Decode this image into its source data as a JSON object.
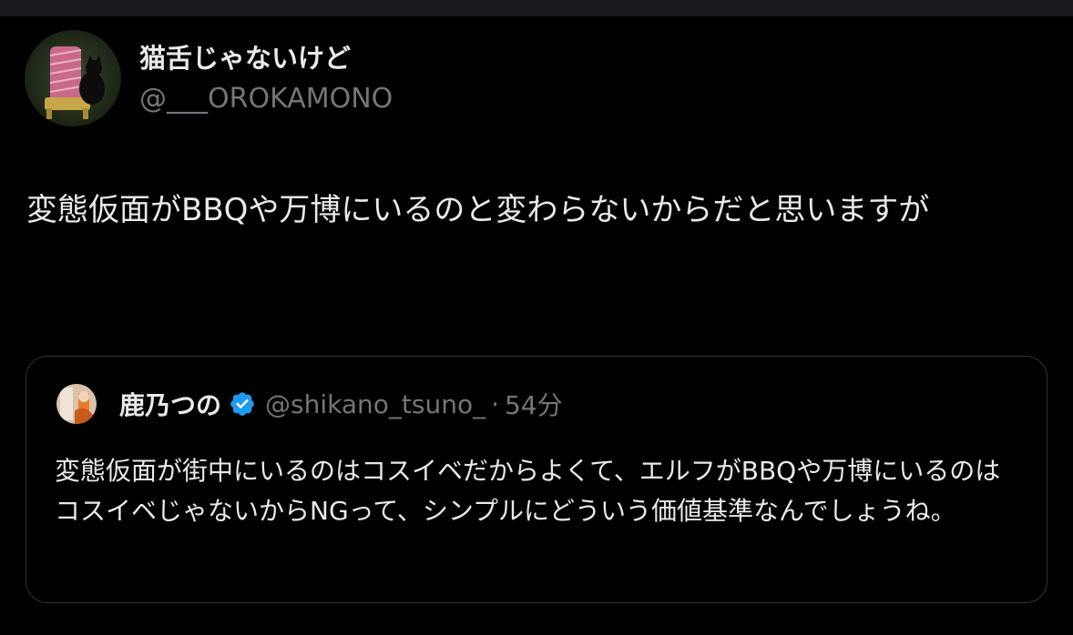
{
  "post": {
    "author_name": "猫舌じゃないけど",
    "author_handle": "@___OROKAMONO",
    "text": "変態仮面がBBQや万博にいるのと変わらないからだと思いますが"
  },
  "quoted": {
    "author_name": "鹿乃つの",
    "author_handle": "@shikano_tsuno_",
    "separator": "·",
    "time": "54分",
    "text": "変態仮面が街中にいるのはコスイベだからよくて、エルフがBBQや万博にいるのはコスイベじゃないからNGって、シンプルにどういう価値基準なんでしょうね。",
    "verified": true
  },
  "colors": {
    "background": "#000000",
    "text": "#e7e9ea",
    "muted": "#71767b",
    "border": "#2f3336",
    "verified": "#1d9bf0"
  },
  "icons": {
    "author_avatar": "avatar-image",
    "quoted_avatar": "avatar-image",
    "verified": "verified-badge-icon"
  }
}
